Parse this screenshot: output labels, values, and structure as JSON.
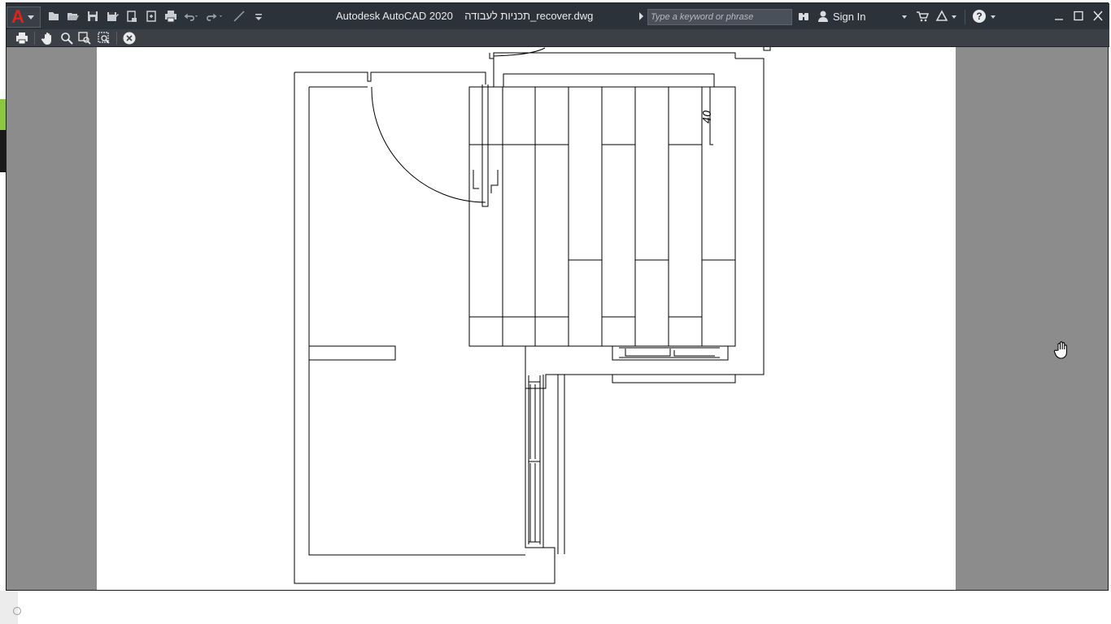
{
  "app": {
    "name": "Autodesk AutoCAD 2020",
    "file_name": "תכניות לעבודה_recover.dwg",
    "logo_letter": "A",
    "accent_color": "#e2231a"
  },
  "title_bar": {
    "search_placeholder": "Type a keyword or phrase",
    "sign_in_label": "Sign In",
    "help_label": "?"
  },
  "quick_access": [
    {
      "icon": "new-icon"
    },
    {
      "icon": "open-icon"
    },
    {
      "icon": "save-icon"
    },
    {
      "icon": "save-as-icon"
    },
    {
      "icon": "open-from-web-icon"
    },
    {
      "icon": "save-to-web-icon"
    },
    {
      "icon": "plot-icon"
    },
    {
      "icon": "undo-icon"
    },
    {
      "icon": "redo-icon"
    },
    {
      "icon": "match-properties-icon"
    },
    {
      "icon": "customize-qat-icon"
    }
  ],
  "preview_toolbar": [
    {
      "icon": "print-icon"
    },
    {
      "icon": "pan-icon"
    },
    {
      "icon": "zoom-icon"
    },
    {
      "icon": "zoom-window-icon"
    },
    {
      "icon": "zoom-original-icon"
    },
    {
      "icon": "close-preview-icon"
    }
  ],
  "drawing": {
    "dimension_text": "40"
  }
}
